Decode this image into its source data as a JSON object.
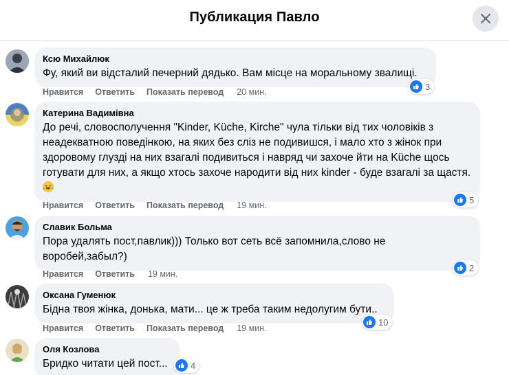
{
  "header": {
    "title": "Публикация Павло"
  },
  "actions": {
    "like": "Нравится",
    "reply": "Ответить",
    "translate": "Показать перевод"
  },
  "comments": [
    {
      "author": "Ксю Михайлюк",
      "text": "Фу, який ви відсталий печерний дядько. Вам місце на моральному звалищі.",
      "time": "20 мин.",
      "reactions": "3",
      "has_translate": true
    },
    {
      "author": "Катерина Вадимівна",
      "text": "До речі, словосполучення \"Kinder, Küche, Kirche\" чула тільки від тих чоловіків з неадекватною поведінкою, на яких без сліз не подивишся, і мало хто з жінок при здоровому глузді на них взагалі подивиться і навряд чи захоче йти на Küche щось готувати для них, а якщо хтось захоче народити від них kinder - буде взагалі за щастя.",
      "emoji": "laughing-face",
      "time": "19 мин.",
      "reactions": "5",
      "has_translate": true
    },
    {
      "author": "Славик Больма",
      "text": "Пора удалять пост,павлик))) Только вот сеть всё запомнила,слово не воробей,забыл?)",
      "time": "19 мин.",
      "reactions": "2",
      "has_translate": false
    },
    {
      "author": "Оксана Гуменюк",
      "text": "Бідна твоя жінка, донька, мати... це ж треба таким недолугим бути..",
      "time": "19 мин.",
      "reactions": "10",
      "has_translate": true
    },
    {
      "author": "Оля Козлова",
      "text": "Бридко читати цей пост...",
      "reactions": "4"
    }
  ],
  "colors": {
    "like_blue": "#1877f2",
    "bubble": "#f0f2f5",
    "meta": "#65676b"
  }
}
